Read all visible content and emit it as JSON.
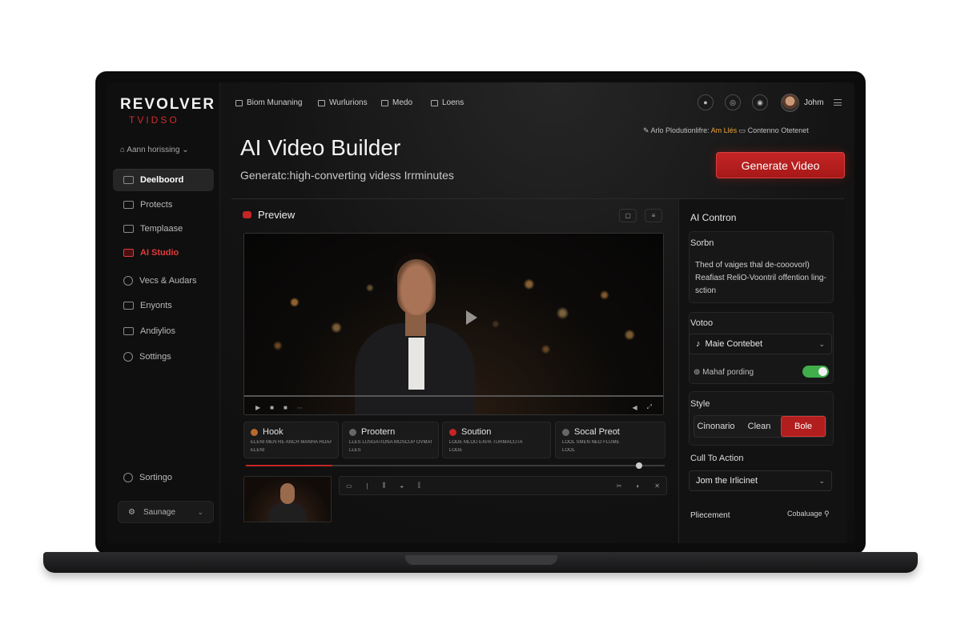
{
  "brand": {
    "line1": "REVOLVER",
    "line2": "TVIDSO"
  },
  "workspace_label": "Aann horissing",
  "sidebar": {
    "items": [
      {
        "label": "Deelboord"
      },
      {
        "label": "Protects"
      },
      {
        "label": "Templaase"
      },
      {
        "label": "AI Studio"
      },
      {
        "label": "Vecs & Audars"
      },
      {
        "label": "Enyonts"
      },
      {
        "label": "Andiylios"
      },
      {
        "label": "Sottings"
      },
      {
        "label": "Sortingo"
      }
    ],
    "bottom_button": "Saunage"
  },
  "topnav": {
    "items": [
      {
        "label": "Biom Munaning"
      },
      {
        "label": "Wurlurions"
      },
      {
        "label": "Medo"
      },
      {
        "label": "Loens"
      }
    ],
    "user": {
      "name": "Johm"
    }
  },
  "status_line": {
    "prefix": "Arlo Plodutionlifre:",
    "accent": "Am Llés",
    "suffix": "Contenno Otetenet"
  },
  "header": {
    "title": "AI Video Builder",
    "subtitle": "Generatc:high-converting videss Irrminutes",
    "generate_button": "Generate Video"
  },
  "preview": {
    "title": "Preview"
  },
  "scenes": [
    {
      "title": "Hook",
      "sub": "ELENI MEN RE ANCH MANHA HOAA",
      "sub2": "ELENI"
    },
    {
      "title": "Prootern",
      "sub": "LLES LUSGATIONA MOSCUP OVMAN",
      "sub2": "LLES"
    },
    {
      "title": "Soution",
      "sub": "LODE MLOU EXPA TURMACUTA",
      "sub2": "LODE"
    },
    {
      "title": "Socal Preot",
      "sub": "LOOL SMEN NEO FLUME",
      "sub2": "LOOL"
    }
  ],
  "ai_panel": {
    "title": "AI Contron",
    "script_label": "Sorbn",
    "script_text": "Thed of vaiges thal de-cooovorl) Reafiast ReliO-Voontril offention ling-sction",
    "voice_label": "Votoo",
    "voice_value": "Maie  Contebet",
    "toggle_label": "Mahaf pording",
    "toggle_on": true,
    "style_label": "Style",
    "style_options": [
      "Cinonario",
      "Clean",
      "Bole"
    ],
    "style_active": "Bole",
    "cta_label": "Cull To Action",
    "cta_value": "Jom the Irlicinet",
    "placement_label": "Pliecement",
    "placement_value": "Cobaluage"
  },
  "colors": {
    "accent": "#c42525",
    "toggle": "#3fae4b",
    "status_accent": "#e8a23a"
  }
}
